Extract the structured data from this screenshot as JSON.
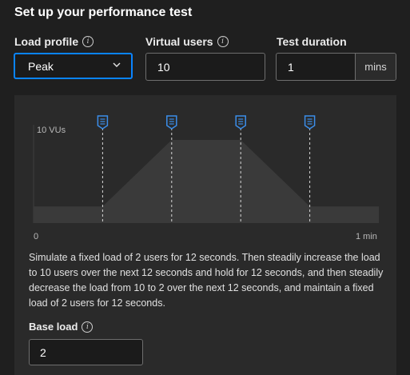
{
  "title": "Set up your performance test",
  "load_profile": {
    "label": "Load profile",
    "value": "Peak"
  },
  "virtual_users": {
    "label": "Virtual users",
    "value": "10"
  },
  "test_duration": {
    "label": "Test duration",
    "value": "1",
    "unit": "mins"
  },
  "chart": {
    "y_label": "10 VUs",
    "x_start": "0",
    "x_end": "1 min"
  },
  "chart_data": {
    "type": "area",
    "x": [
      0,
      12,
      24,
      36,
      48,
      60
    ],
    "values": [
      2,
      2,
      10,
      10,
      2,
      2
    ],
    "markers": [
      12,
      24,
      36,
      48
    ],
    "xlim": [
      0,
      60
    ],
    "ylim": [
      0,
      10
    ]
  },
  "description": "Simulate a fixed load of 2 users for 12 seconds. Then steadily increase the load to 10 users over the next 12 seconds and hold for 12 seconds, and then steadily decrease the load from 10 to 2 over the next 12 seconds, and maintain a fixed load of 2 users for 12 seconds.",
  "base_load": {
    "label": "Base load",
    "value": "2"
  },
  "colors": {
    "accent": "#0a84ff",
    "marker": "#3b8eea",
    "area": "#3a3a3a"
  }
}
